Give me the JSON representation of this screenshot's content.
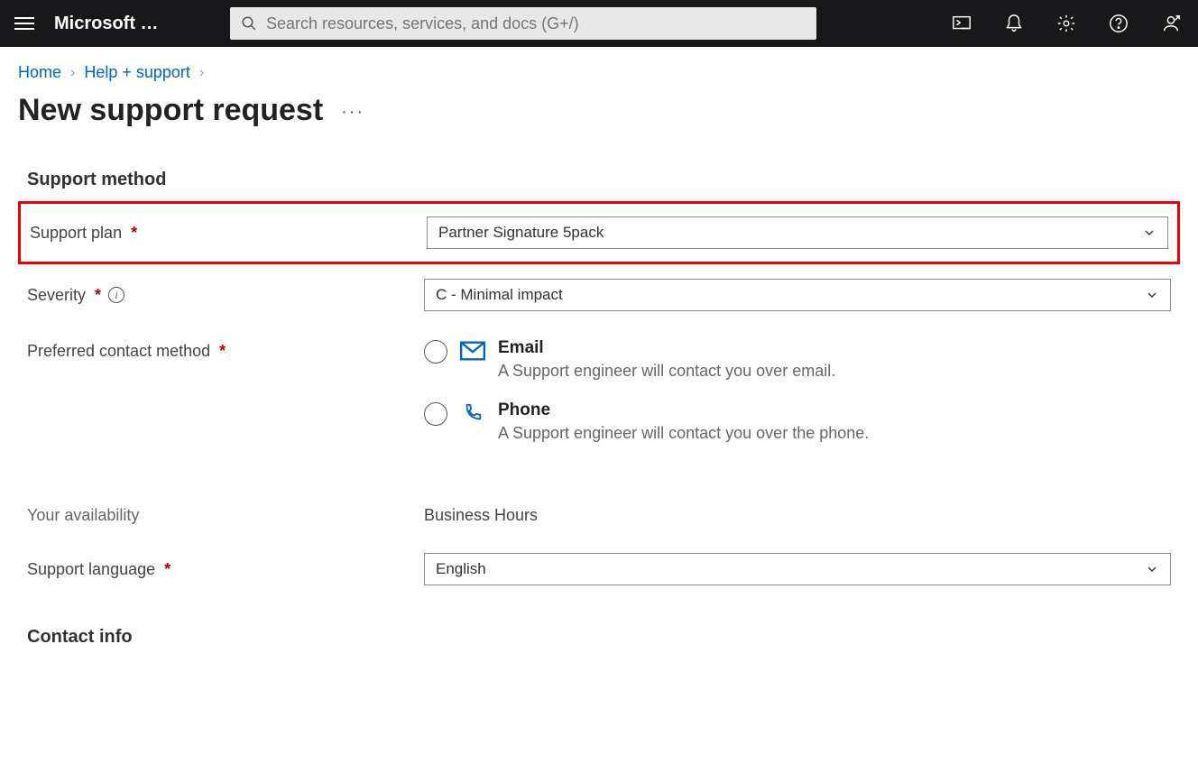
{
  "header": {
    "brand": "Microsoft …",
    "search_placeholder": "Search resources, services, and docs (G+/)"
  },
  "breadcrumb": {
    "home": "Home",
    "help_support": "Help + support"
  },
  "page": {
    "title": "New support request"
  },
  "sections": {
    "support_method": "Support method",
    "contact_info": "Contact info"
  },
  "form": {
    "support_plan": {
      "label": "Support plan",
      "value": "Partner Signature 5pack"
    },
    "severity": {
      "label": "Severity",
      "value": "C - Minimal impact"
    },
    "preferred_contact": {
      "label": "Preferred contact method",
      "email": {
        "title": "Email",
        "desc": "A Support engineer will contact you over email."
      },
      "phone": {
        "title": "Phone",
        "desc": "A Support engineer will contact you over the phone."
      }
    },
    "availability": {
      "label": "Your availability",
      "value": "Business Hours"
    },
    "support_language": {
      "label": "Support language",
      "value": "English"
    }
  }
}
